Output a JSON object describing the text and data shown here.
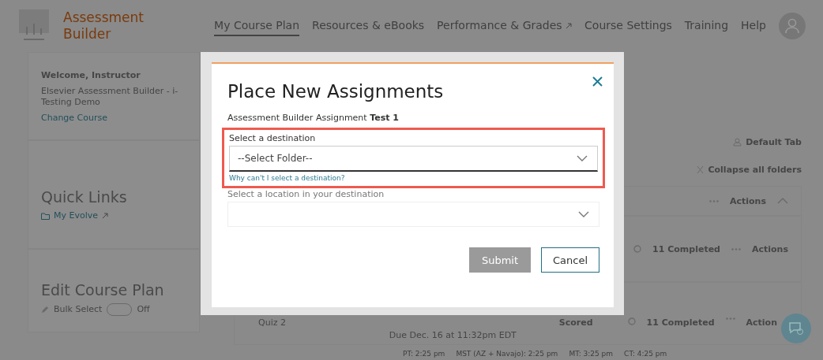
{
  "header": {
    "logo_lines": [
      "Assessment",
      "Builder"
    ],
    "nav": [
      {
        "label": "My Course Plan",
        "selected": true,
        "external": false
      },
      {
        "label": "Resources & eBooks",
        "selected": false,
        "external": false
      },
      {
        "label": "Performance & Grades",
        "selected": false,
        "external": true
      },
      {
        "label": "Course Settings",
        "selected": false,
        "external": false
      },
      {
        "label": "Training",
        "selected": false,
        "external": false
      },
      {
        "label": "Help",
        "selected": false,
        "external": false
      }
    ]
  },
  "sidebar": {
    "welcome": {
      "title": "Welcome, Instructor",
      "course": "Elsevier Assessment Builder - i-Testing Demo",
      "link": "Change Course"
    },
    "quick_links": {
      "title": "Quick Links",
      "items": [
        {
          "label": "My Evolve",
          "external": true
        }
      ]
    },
    "edit_plan": {
      "title": "Edit Course Plan",
      "toggles": [
        {
          "label": "Bulk Select",
          "on": false,
          "state_text": "Off"
        }
      ]
    }
  },
  "main": {
    "default_tab": "Default Tab",
    "collapse": "Collapse all folders",
    "folder": {
      "actions": "Actions",
      "expanded": true
    },
    "rows": [
      {
        "title": "",
        "due": "",
        "status": "",
        "completed": "11 Completed",
        "actions": "Actions"
      },
      {
        "title": "Quiz 2",
        "due": "Due Dec. 16 at 11:32pm EDT",
        "status": "Scored",
        "completed": "11 Completed",
        "actions": "Action"
      }
    ]
  },
  "status_bar": [
    "PT: 2:25 pm",
    "MST (AZ + Navajo): 2:25 pm",
    "MT: 3:25 pm",
    "CT: 4:25 pm"
  ],
  "modal": {
    "title": "Place New Assignments",
    "subtitle": "Assessment Builder Assignment **Test 1**",
    "destination": {
      "label": "Select a destination",
      "value": "--Select Folder--",
      "highlighted": true,
      "help_link": "Why can't I select a destination?"
    },
    "location": {
      "label": "Select a location in your destination",
      "disabled": true
    },
    "buttons": [
      {
        "label": "Submit",
        "kind": "primary",
        "disabled": true
      },
      {
        "label": "Cancel",
        "kind": "secondary",
        "disabled": false
      }
    ]
  }
}
